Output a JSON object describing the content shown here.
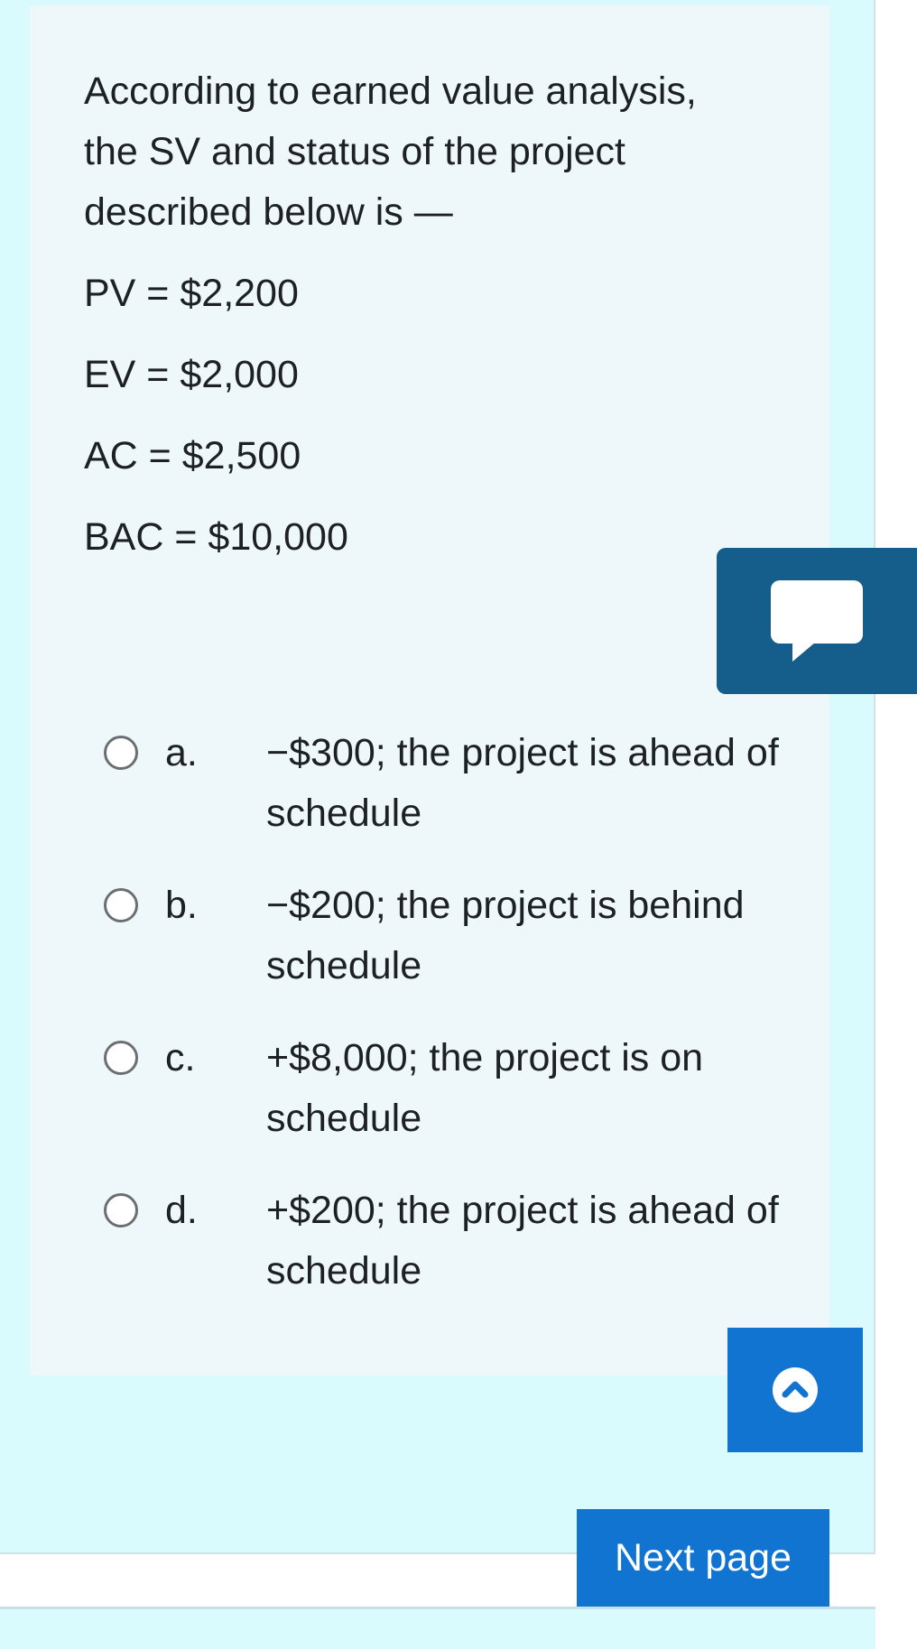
{
  "question": {
    "lines": [
      "According to earned value analysis,",
      "the SV and status of the project",
      "described below is —"
    ],
    "given": [
      "PV = $2,200",
      "EV = $2,000",
      "AC = $2,500",
      "BAC = $10,000"
    ]
  },
  "options": [
    {
      "letter": "a.",
      "line1": "−$300; the project is ahead of",
      "line2": "schedule"
    },
    {
      "letter": "b.",
      "line1": "−$200; the project is behind",
      "line2": "schedule"
    },
    {
      "letter": "c.",
      "line1": "+$8,000; the project is on",
      "line2": "schedule"
    },
    {
      "letter": "d.",
      "line1": "+$200; the project is ahead of",
      "line2": "schedule"
    }
  ],
  "icons": {
    "comment": "comment-bubble-icon",
    "scroll_top": "chevron-up-icon",
    "radio": "radio-unchecked-icon"
  },
  "colors": {
    "page_bg": "#dafbfd",
    "card_bg": "#eef8fa",
    "primary_button": "#1274d1",
    "comment_button": "#155e8b"
  },
  "navigation": {
    "next_label": "Next page"
  }
}
